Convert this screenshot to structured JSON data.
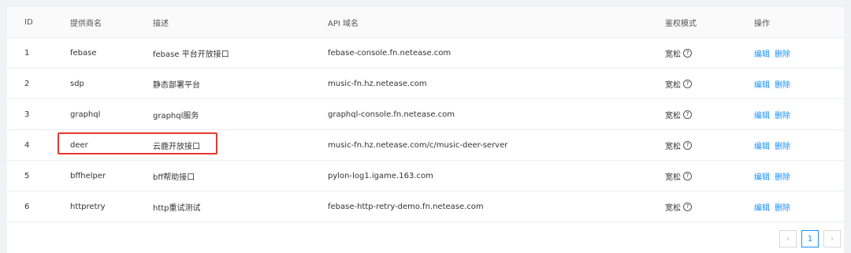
{
  "table": {
    "headers": [
      "ID",
      "提供商名",
      "描述",
      "API 域名",
      "鉴权模式",
      "操作"
    ],
    "rows": [
      {
        "id": "1",
        "name": "febase",
        "desc": "febase 平台开放接口",
        "api": "febase-console.fn.netease.com",
        "auth": "宽松",
        "edit": "编辑",
        "del": "删除"
      },
      {
        "id": "2",
        "name": "sdp",
        "desc": "静态部署平台",
        "api": "music-fn.hz.netease.com",
        "auth": "宽松",
        "edit": "编辑",
        "del": "删除"
      },
      {
        "id": "3",
        "name": "graphql",
        "desc": "graphql服务",
        "api": "graphql-console.fn.netease.com",
        "auth": "宽松",
        "edit": "编辑",
        "del": "删除"
      },
      {
        "id": "4",
        "name": "deer",
        "desc": "云鹿开放接口",
        "api": "music-fn.hz.netease.com/c/music-deer-server",
        "auth": "宽松",
        "edit": "编辑",
        "del": "删除"
      },
      {
        "id": "5",
        "name": "bffhelper",
        "desc": "bff帮助接口",
        "api": "pylon-log1.igame.163.com",
        "auth": "宽松",
        "edit": "编辑",
        "del": "删除"
      },
      {
        "id": "6",
        "name": "httpretry",
        "desc": "http重试测试",
        "api": "febase-http-retry-demo.fn.netease.com",
        "auth": "宽松",
        "edit": "编辑",
        "del": "删除"
      }
    ]
  },
  "pagination": {
    "prev": "‹",
    "current": "1",
    "next": "›"
  },
  "colors": {
    "accent": "#1890ff",
    "highlight": "#e53a2f"
  }
}
